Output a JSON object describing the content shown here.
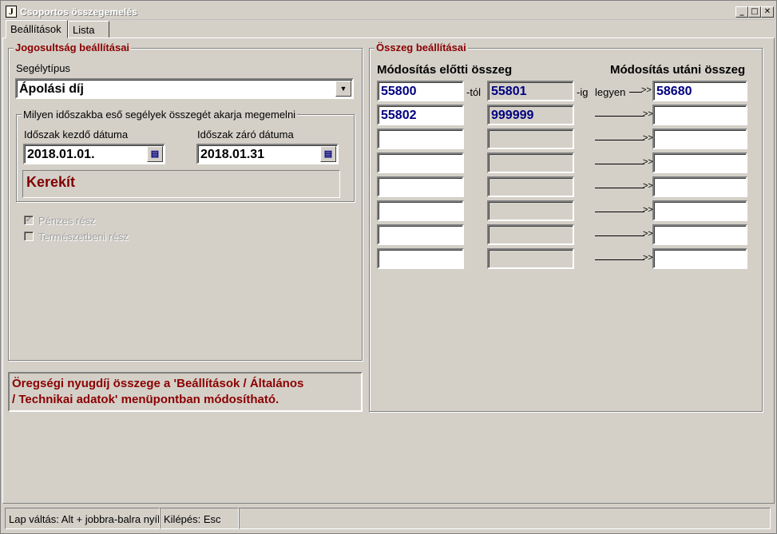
{
  "window": {
    "icon_letter": "J",
    "title": "Csoportos összegemelés",
    "min": "_",
    "max": "□",
    "close": "✕"
  },
  "tabs": [
    {
      "label": "Beállítások"
    },
    {
      "label": "Lista"
    }
  ],
  "left": {
    "group_title": "Jogosultság beállításai",
    "segelytipus_label": "Segélytípus",
    "segelytipus_value": "Ápolási díj",
    "period_group_title": "Milyen időszakba eső segélyek összegét akarja megemelni",
    "start_label": "Időszak kezdő dátuma",
    "start_value": "2018.01.01.",
    "end_label": "Időszak záró dátuma",
    "end_value": "2018.01.31",
    "kerekit": "Kerekít",
    "penzes_label": "Pénzes rész",
    "penzes_checked": true,
    "termeszetbeni_label": "Természetbeni rész",
    "termeszetbeni_checked": false,
    "info_line1": "Öregségi nyugdíj összege a 'Beállítások / Általános",
    "info_line2": "/ Technikai adatok' menüpontban módosítható."
  },
  "right": {
    "group_title": "Összeg beállításai",
    "header_before": "Módosítás előtti összeg",
    "header_after": "Módosítás utáni összeg",
    "tol_label": "-tól",
    "ig_label": "-ig",
    "legyen_label": "legyen",
    "arrow_head": ">>",
    "rows": [
      {
        "from": "55800",
        "to": "55801",
        "new": "58680"
      },
      {
        "from": "55802",
        "to": "999999",
        "new": ""
      },
      {
        "from": "",
        "to": "",
        "new": ""
      },
      {
        "from": "",
        "to": "",
        "new": ""
      },
      {
        "from": "",
        "to": "",
        "new": ""
      },
      {
        "from": "",
        "to": "",
        "new": ""
      },
      {
        "from": "",
        "to": "",
        "new": ""
      },
      {
        "from": "",
        "to": "",
        "new": ""
      }
    ]
  },
  "status": {
    "nav": "Lap váltás: Alt + jobbra-balra nyíl",
    "exit": "Kilépés: Esc",
    "extra": ""
  },
  "colors": {
    "accent_dark_red": "#8b0000",
    "value_navy": "#000080",
    "face": "#d4d0c8"
  }
}
